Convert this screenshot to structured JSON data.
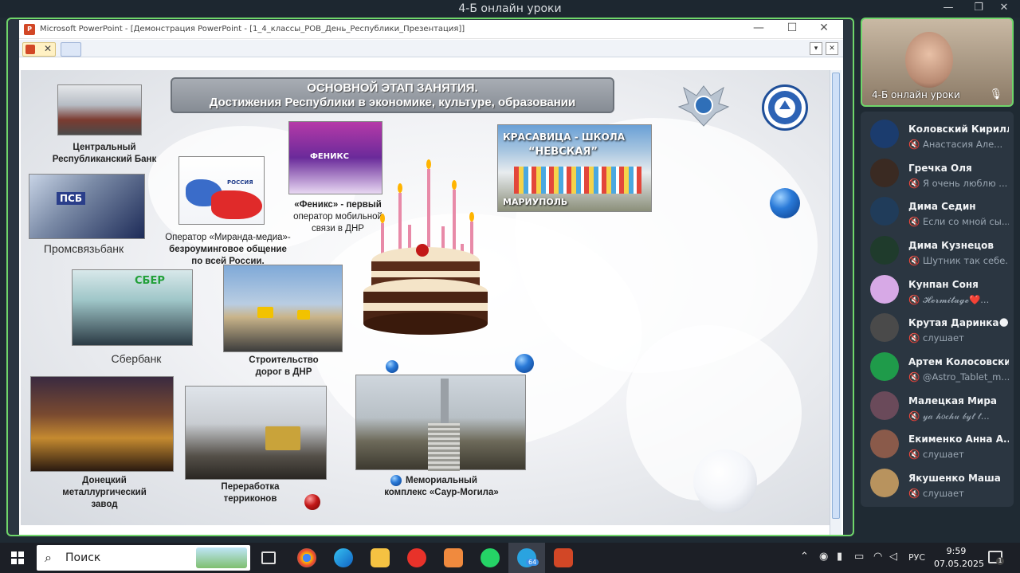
{
  "window": {
    "title": "4-Б онлайн уроки",
    "min": "—",
    "max": "❐",
    "close": "✕"
  },
  "powerpoint": {
    "title": "Microsoft PowerPoint - [Демонстрация PowerPoint - [1_4_классы_РОВ_День_Республики_Презентация]]",
    "min": "—",
    "max": "☐",
    "close": "✕",
    "tab_close": "✕",
    "dropdown": "▾",
    "pane_close": "✕"
  },
  "slide": {
    "banner_line1": "ОСНОВНОЙ ЭТАП ЗАНЯТИЯ.",
    "banner_line2": "Достижения Республики в экономике, культуре,  образовании",
    "captions": {
      "bank_line1": "Центральный",
      "bank_line2": "Республиканский Банк",
      "psb": "Промсвязьбанк",
      "miranda_line1": "Оператор «Миранда-медиа»-",
      "miranda_line2": "безроуминговое общение",
      "miranda_line3": "по всей России.",
      "phoenix_line1": "«Феникс» - первый",
      "phoenix_line2": "оператор мобильной",
      "phoenix_line3": "связи в ДНР",
      "sber": "Сбербанк",
      "roads_line1": "Строительство",
      "roads_line2": "дорог в ДНР",
      "metal_line1": "Донецкий",
      "metal_line2": "металлургический",
      "metal_line3": "завод",
      "terricon_line1": "Переработка",
      "terricon_line2": "терриконов",
      "memorial_line1": "Мемориальный",
      "memorial_line2": "комплекс «Саур-Могила»"
    },
    "photo_text": {
      "psb_sign": "ПСБ",
      "sber_sign": "СБЕР",
      "phoenix_sign": "ФЕНИКС",
      "russia_label": "РОССИЯ",
      "school_line1": "КРАСАВИЦА - ШКОЛА",
      "school_line2": "“НЕВСКАЯ”",
      "school_city": "МАРИУПОЛЬ"
    }
  },
  "self_video": {
    "label": "4-Б онлайн уроки",
    "mic_icon": "🎙"
  },
  "participants": [
    {
      "name": "Коловский Кирилл",
      "status": "Анастасия Але..."
    },
    {
      "name": "Гречка Оля",
      "status": "Я очень люблю ..."
    },
    {
      "name": "Дима Седин",
      "status": "Если со мной сы..."
    },
    {
      "name": "Дима Кузнецов",
      "status": "Шутник так себе..."
    },
    {
      "name": "Кунпан Соня",
      "status": "𝓗𝓮𝓻𝓶𝓲𝓽𝓪𝓰𝓮❤️..."
    },
    {
      "name": "Крутая Даринка🌑",
      "status": "слушает"
    },
    {
      "name": "Артем Колосовский",
      "status": "@Astro_Tablet_m..."
    },
    {
      "name": "Малецкая Мира",
      "status": "𝓎𝒶 𝒽𝑜𝒸𝒽𝓊 𝒷𝓎𝓉 𝓉..."
    },
    {
      "name": "Екименко Анна А...",
      "status": "слушает"
    },
    {
      "name": "Якушенко Маша",
      "status": "слушает"
    }
  ],
  "participant_muted_icon": "🔇",
  "avatar_colors": [
    "#1b3c6e",
    "#3a2a22",
    "#203c5a",
    "#1f3b2c",
    "#d7a9e6",
    "#4a4a4a",
    "#1f9b4a",
    "#6a4a5a",
    "#8a5a4a",
    "#b8935e"
  ],
  "taskbar": {
    "start_icon": "windows-logo",
    "search_placeholder": "Поиск",
    "search_glyph": "⌕",
    "telegram_badge": "64",
    "language": "РУС",
    "time": "9:59",
    "date": "07.05.2025",
    "notifications": "1"
  },
  "colors": {
    "active_border": "#6fd66a",
    "panel_bg": "#2b3641",
    "accent_blue": "#2a7ad8"
  }
}
